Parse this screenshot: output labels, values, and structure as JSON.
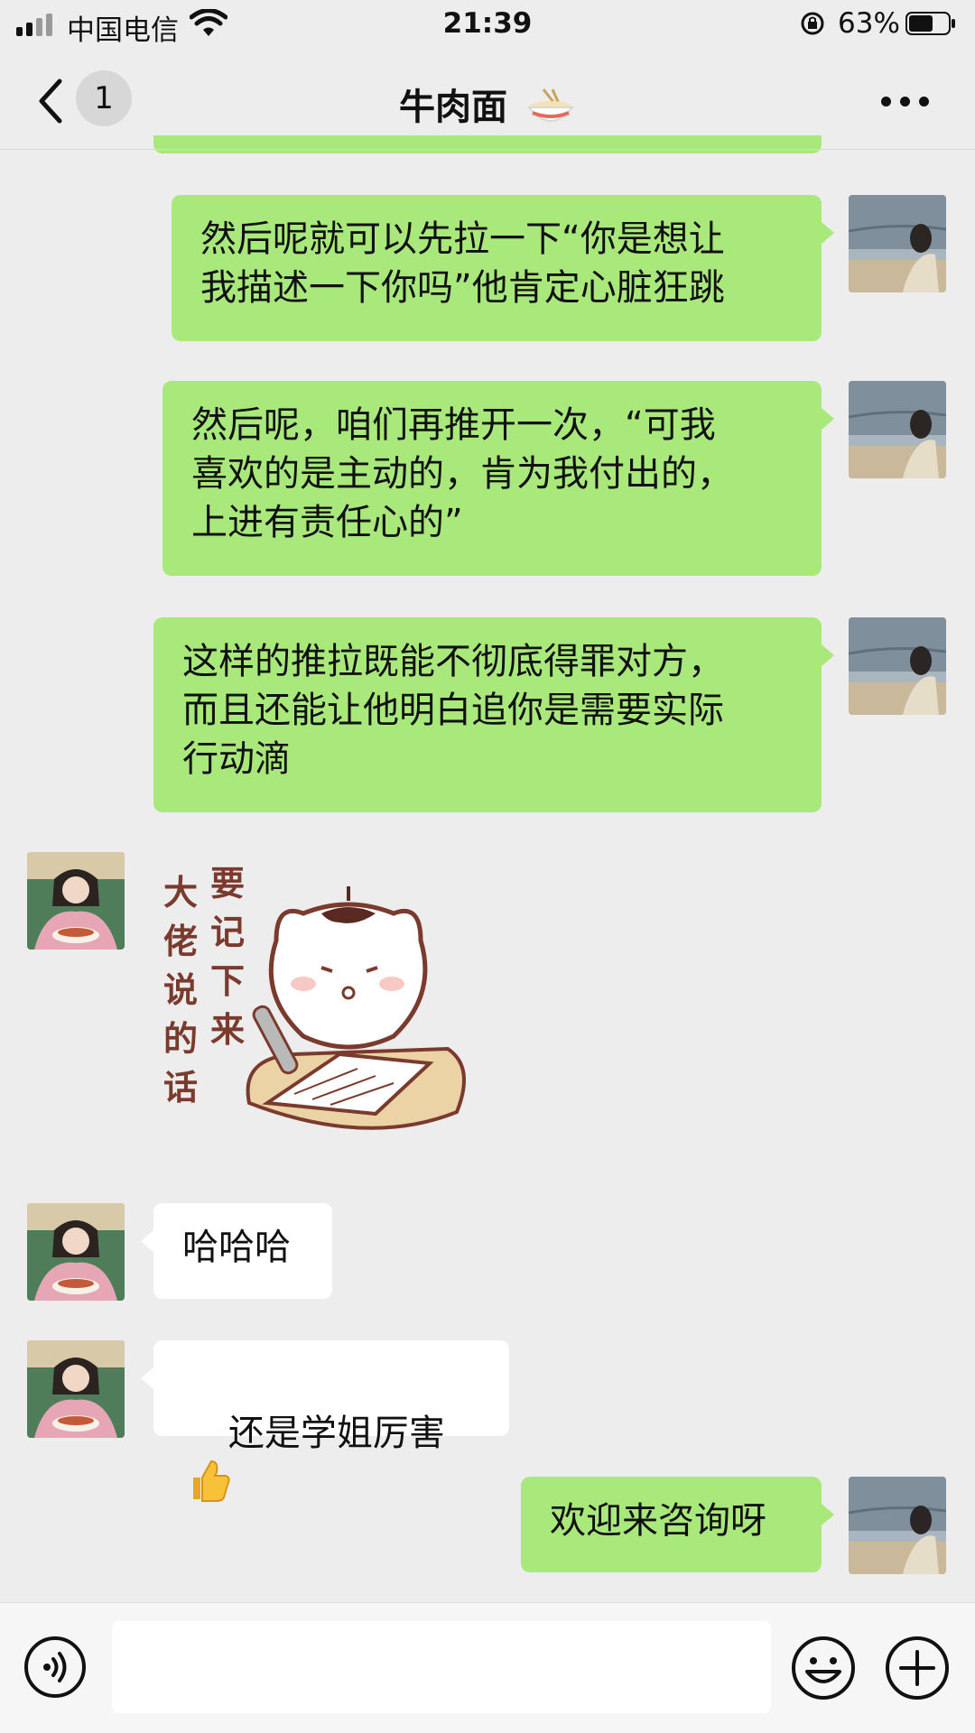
{
  "status_bar": {
    "carrier": "中国电信",
    "time": "21:39",
    "battery_percent": "63%",
    "battery_level": 0.63,
    "icons": [
      "signal-icon",
      "wifi-icon",
      "rotation-lock-icon",
      "battery-icon"
    ]
  },
  "nav": {
    "unread_count": "1",
    "title": "牛肉面",
    "title_emoji": "noodle-bowl-icon",
    "icons": [
      "back-chevron-icon",
      "more-dots-icon"
    ]
  },
  "messages": [
    {
      "side": "me",
      "type": "text",
      "text": "然后呢就可以先拉一下“你是想让\n我描述一下你吗”他肯定心脏狂跳"
    },
    {
      "side": "me",
      "type": "text",
      "text": "然后呢，咱们再推开一次，“可我\n喜欢的是主动的，肯为我付出的，\n上进有责任心的”"
    },
    {
      "side": "me",
      "type": "text",
      "text": "这样的推拉既能不彻底得罪对方，\n而且还能让他明白追你是需要实际\n行动滴"
    },
    {
      "side": "other",
      "type": "sticker",
      "sticker_lines": [
        "大佬说的话",
        "要记下来"
      ]
    },
    {
      "side": "other",
      "type": "text",
      "text": "哈哈哈"
    },
    {
      "side": "other",
      "type": "text",
      "text": "还是学姐厉害",
      "emoji": "thumbs-up-icon"
    },
    {
      "side": "me",
      "type": "text",
      "text": "欢迎来咨询呀"
    }
  ],
  "input_bar": {
    "placeholder": "",
    "icons": [
      "voice-icon",
      "emoji-icon",
      "plus-icon"
    ]
  },
  "colors": {
    "background": "#ededed",
    "my_bubble": "#a9e87a",
    "other_bubble": "#ffffff",
    "input_bar": "#f6f6f6"
  }
}
